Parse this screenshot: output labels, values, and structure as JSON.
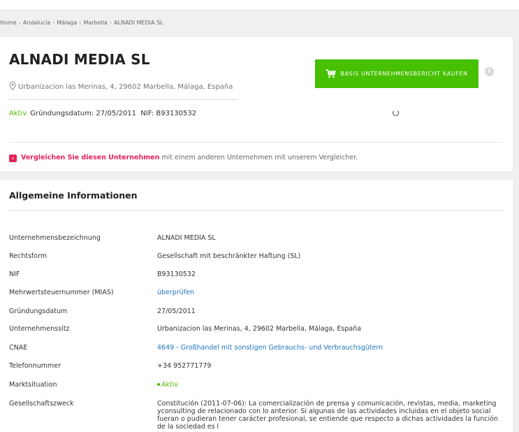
{
  "breadcrumb": [
    "Home",
    "Andalucía",
    "Málaga",
    "Marbella",
    "ALNADI MEDIA SL"
  ],
  "company": {
    "name": "ALNADI MEDIA SL",
    "address": "Urbanizacion las Merinas, 4, 29602 Marbella, Málaga, España",
    "status": "Aktiv",
    "founding": "Gründungsdatum: 27/05/2011",
    "nif": "NIF: B93130532"
  },
  "buy_button": {
    "label": "BASIS UNTERNEHMENSBERICHT KAUFEN",
    "icon": "cart-icon"
  },
  "compare": {
    "link_text": "Vergleichen Sie diesen Unternehmen",
    "rest_text": " mit einem anderen Unternehmen mit unserem Vergleicher."
  },
  "general": {
    "title": "Allgemeine Informationen",
    "rows": [
      {
        "label": "Unternehmensbezeichnung",
        "value": "ALNADI MEDIA SL"
      },
      {
        "label": "Rechtsform",
        "value": "Gesellschaft mit beschränkter Haftung (SL)"
      },
      {
        "label": "NIF",
        "value": "B93130532"
      },
      {
        "label": "Mehrwertsteuernummer (MIAS)",
        "value": "überprüfen"
      },
      {
        "label": "Gründungsdatum",
        "value": "27/05/2011"
      },
      {
        "label": "Unternehmenssitz",
        "value": "Urbanizacion las Merinas, 4, 29602 Marbella, Málaga, España"
      },
      {
        "label": "CNAE",
        "value": "4649 - Großhandel mit sonstigen Gebrauchs- und Verbrauchsgütern"
      },
      {
        "label": "Telefonnummer",
        "value": "+34 952771779"
      },
      {
        "label": "Marktsituation",
        "value": "Aktiv"
      },
      {
        "label": "Gesellschaftszweck",
        "value": "Constitución (2011-07-06): La comercialización de prensa y comunicación, revistas, media, marketing yconsulting de relacionado con lo anterior. Si algunas de las actividades incluidas en el objeto social fueran o pudieran tener carácter profesional, se entiende que respecto a dichas actividades la función de la sociedad es l"
      }
    ]
  },
  "colors": {
    "accent_green": "#46c000",
    "link_blue": "#1e73be",
    "compare_red": "#e5245a",
    "active_green": "#5cb800"
  }
}
